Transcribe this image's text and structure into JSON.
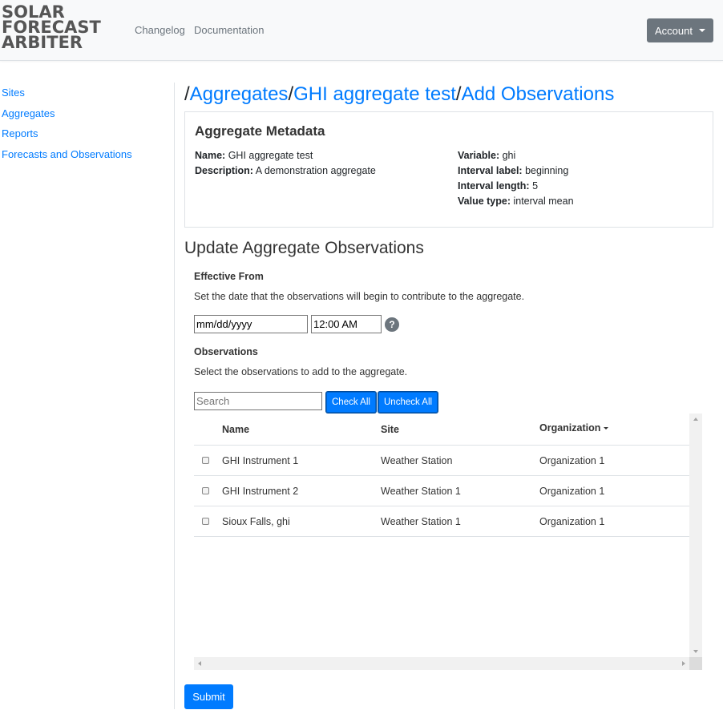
{
  "brand": {
    "line1": "SOLAR",
    "line2": "FORECAST",
    "line3": "ARBITER"
  },
  "nav": {
    "changelog": "Changelog",
    "documentation": "Documentation",
    "account": "Account"
  },
  "sidebar": {
    "items": [
      {
        "label": "Sites"
      },
      {
        "label": "Aggregates"
      },
      {
        "label": "Reports"
      },
      {
        "label": "Forecasts and Observations"
      }
    ]
  },
  "breadcrumb": {
    "sep": "/",
    "aggregates": "Aggregates",
    "aggregate": "GHI aggregate test",
    "current": "Add Observations"
  },
  "metadata": {
    "title": "Aggregate Metadata",
    "name_label": "Name:",
    "name": "GHI aggregate test",
    "description_label": "Description:",
    "description": "A demonstration aggregate",
    "variable_label": "Variable:",
    "variable": "ghi",
    "interval_label_label": "Interval label:",
    "interval_label": "beginning",
    "interval_length_label": "Interval length:",
    "interval_length": "5",
    "value_type_label": "Value type:",
    "value_type": "interval mean"
  },
  "form": {
    "title": "Update Aggregate Observations",
    "effective_from_label": "Effective From",
    "effective_from_help": "Set the date that the observations will begin to contribute to the aggregate.",
    "date_value": "mm/dd/yyyy",
    "time_value": "12:00 AM",
    "help_icon": "?",
    "observations_label": "Observations",
    "observations_help": "Select the observations to add to the aggregate.",
    "search_placeholder": "Search",
    "check_all": "Check All",
    "uncheck_all": "Uncheck All",
    "submit": "Submit"
  },
  "table": {
    "columns": {
      "name": "Name",
      "site": "Site",
      "organization": "Organization"
    },
    "rows": [
      {
        "name": "GHI Instrument 1",
        "site": "Weather Station",
        "organization": "Organization 1"
      },
      {
        "name": "GHI Instrument 2",
        "site": "Weather Station 1",
        "organization": "Organization 1"
      },
      {
        "name": "Sioux Falls, ghi",
        "site": "Weather Station 1",
        "organization": "Organization 1"
      }
    ]
  }
}
